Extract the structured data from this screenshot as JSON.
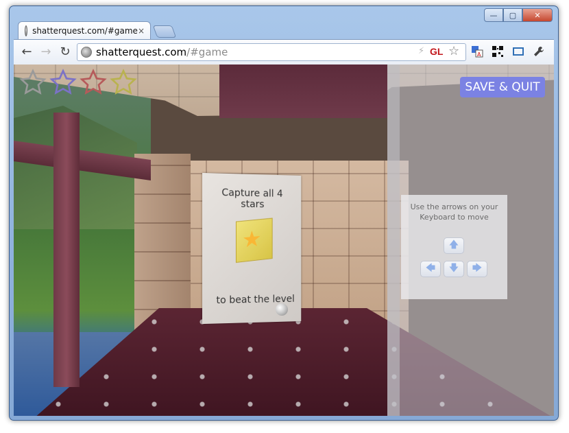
{
  "window": {
    "controls": {
      "minimize": "—",
      "maximize": "▢",
      "close": "✕"
    }
  },
  "tab": {
    "title": "shatterquest.com/#game",
    "close": "×"
  },
  "toolbar": {
    "back": "←",
    "forward": "→",
    "reload": "↻",
    "url_host": "shatterquest.com",
    "url_path": "/#game",
    "gl_badge": "GL",
    "bolt": "⚡",
    "bookmark": "☆",
    "extensions": [
      "translate-icon",
      "qr-code-icon",
      "fullscreen-icon",
      "wrench-icon"
    ]
  },
  "game": {
    "star_colors": [
      "#9a9a9a",
      "#7b72c7",
      "#b65a5a",
      "#b9b24f"
    ],
    "save_quit_label": "SAVE & QUIT",
    "sign": {
      "line1": "Capture all 4 stars",
      "line2": "to beat the level"
    },
    "instructions": {
      "text": "Use the arrows on your Keyboard to move"
    },
    "keys": {
      "up": "🡅",
      "left": "🡄",
      "down": "🡇",
      "right": "🡆"
    }
  }
}
